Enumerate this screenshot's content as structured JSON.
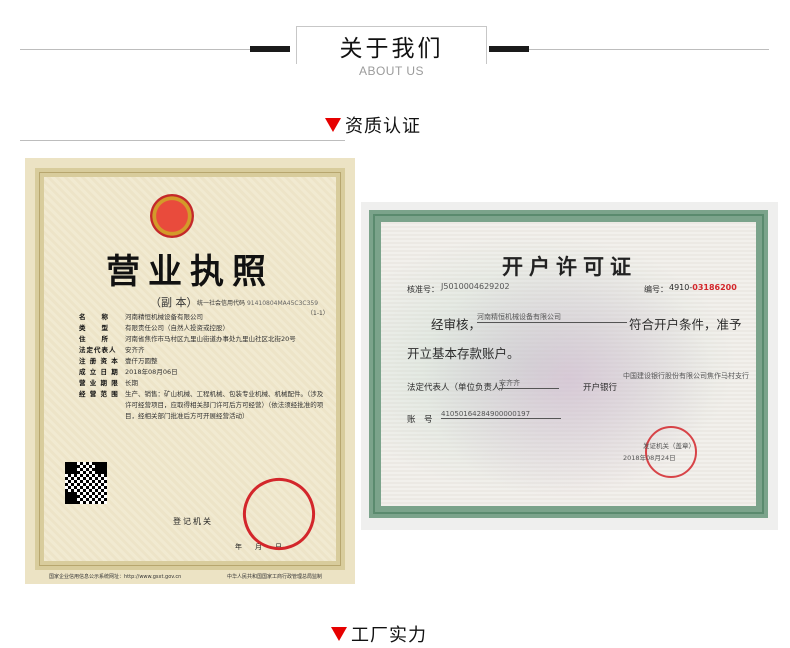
{
  "header": {
    "title": "关于我们",
    "subtitle": "ABOUT US"
  },
  "sections": {
    "qualification": "资质认证",
    "factory": "工厂实力"
  },
  "colors": {
    "accent": "#e60000",
    "rule": "#1a1a1a"
  },
  "business_license": {
    "title": "营业执照",
    "copy_label": "（副 本）",
    "credit_code_label": "统一社会信用代码",
    "credit_code": "91410804MA45C3C359",
    "copy_number": "（1-1）",
    "fields": [
      {
        "label": "名　　称",
        "value": "河南精恒机械设备有限公司"
      },
      {
        "label": "类　　型",
        "value": "有限责任公司（自然人投资或控股）"
      },
      {
        "label": "住　　所",
        "value": "河南省焦作市马村区九里山街道办事处九里山社区北街20号"
      },
      {
        "label": "法定代表人",
        "value": "安齐齐"
      },
      {
        "label": "注 册 资 本",
        "value": "壹仟万圆整"
      },
      {
        "label": "成 立 日 期",
        "value": "2018年08月06日"
      },
      {
        "label": "营 业 期 限",
        "value": "长期"
      },
      {
        "label": "经 营 范 围",
        "value": "生产、销售：矿山机械、工程机械、包装专业机械、机械配件。（涉及许可经营项目，应取得相关部门许可后方可经营）（依法须经批准的项目，经相关部门批准后方可开展经营活动）"
      }
    ],
    "registrar": "登记机关",
    "date": "年　月　日",
    "footer_left": "国家企业信用信息公示系统网址：",
    "footer_url": "http://www.gsxt.gov.cn",
    "footer_right": "中华人民共和国国家工商行政管理总局监制"
  },
  "account_permit": {
    "title": "开户许可证",
    "number_label": "核准号：",
    "number": "J5010004629202",
    "code_label": "编号：",
    "code_prefix": "4910-",
    "code_red": "03186200",
    "line1": "经审核，",
    "company": "河南精恒机械设备有限公司",
    "line1_end": "符合开户条件，准予",
    "line2": "开立基本存款账户。",
    "rep_label": "法定代表人（单位负责人）",
    "rep_value": "安齐齐",
    "bank_label": "开户银行",
    "bank_value": "中国建设银行股份有限公司焦作马村支行",
    "account_label": "账　号",
    "account_value": "41050164284900000197",
    "issuer": "发证机关（盖章）",
    "date": "2018年08月24日"
  }
}
